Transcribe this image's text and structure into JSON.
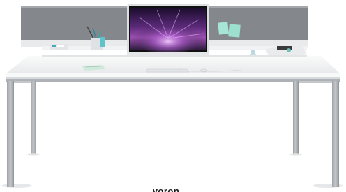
{
  "caption": {
    "text": "voron"
  },
  "product": {
    "colors": {
      "screen_panel": "#7e8186",
      "desktop": "#f4f5f5",
      "frame": "#b7bbbf",
      "floor_shadow": "#e6e7e8",
      "sticky_note": "#9ee0cf"
    }
  }
}
